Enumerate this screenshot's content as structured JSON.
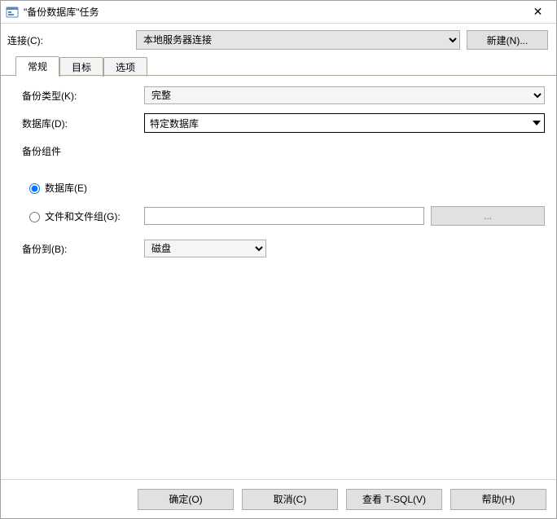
{
  "window": {
    "title": "\"备份数据库\"任务",
    "close_glyph": "✕"
  },
  "connection": {
    "label": "连接(C):",
    "selected": "本地服务器连接",
    "new_button": "新建(N)..."
  },
  "tabs": {
    "general": "常规",
    "target": "目标",
    "options": "选项"
  },
  "form": {
    "backup_type_label": "备份类型(K):",
    "backup_type_value": "完整",
    "database_label": "数据库(D):",
    "database_value": "特定数据库",
    "component_label": "备份组件",
    "radio_db_label": "数据库(E)",
    "radio_fg_label": "文件和文件组(G):",
    "filegroup_value": "",
    "filegroup_btn": "...",
    "backup_to_label": "备份到(B):",
    "backup_to_value": "磁盘"
  },
  "footer": {
    "ok": "确定(O)",
    "cancel": "取消(C)",
    "view_tsql": "查看 T-SQL(V)",
    "help": "帮助(H)"
  }
}
